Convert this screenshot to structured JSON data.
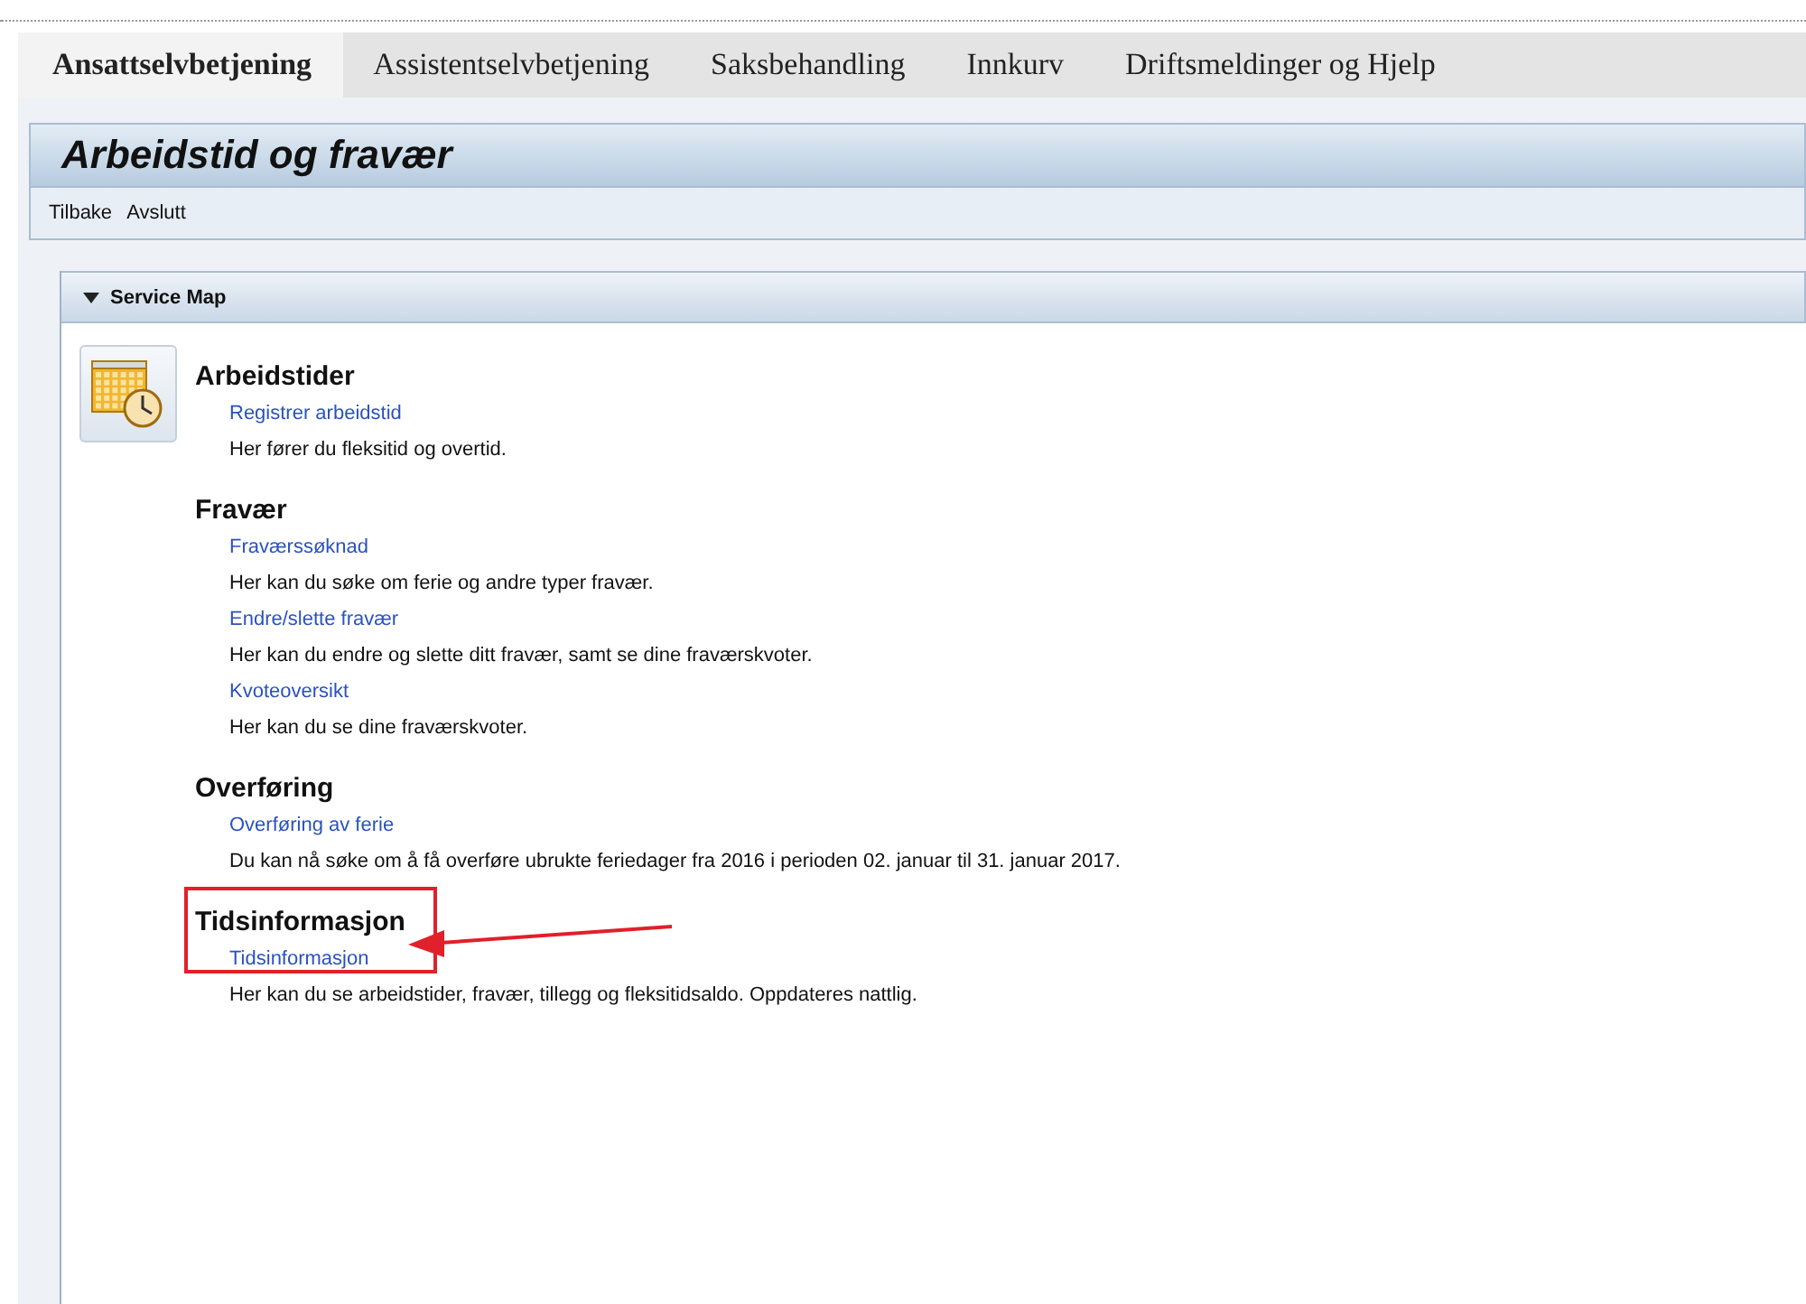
{
  "tabs": [
    {
      "label": "Ansattselvbetjening",
      "selected": true
    },
    {
      "label": "Assistentselvbetjening",
      "selected": false
    },
    {
      "label": "Saksbehandling",
      "selected": false
    },
    {
      "label": "Innkurv",
      "selected": false
    },
    {
      "label": "Driftsmeldinger og Hjelp",
      "selected": false
    }
  ],
  "page": {
    "title": "Arbeidstid og fravær",
    "toolbar": [
      "Tilbake",
      "Avslutt"
    ]
  },
  "service_map": {
    "title": "Service Map",
    "expanded": true,
    "sections": [
      {
        "heading": "Arbeidstider",
        "has_icon": true,
        "highlighted": false,
        "items": [
          {
            "link": "Registrer arbeidstid",
            "description": "Her fører du fleksitid og overtid."
          }
        ]
      },
      {
        "heading": "Fravær",
        "has_icon": false,
        "highlighted": false,
        "items": [
          {
            "link": "Fraværssøknad",
            "description": "Her kan du søke om ferie og andre typer fravær."
          },
          {
            "link": "Endre/slette fravær",
            "description": "Her kan du endre og slette ditt fravær, samt se dine fraværskvoter."
          },
          {
            "link": "Kvoteoversikt",
            "description": "Her kan du se dine fraværskvoter."
          }
        ]
      },
      {
        "heading": "Overføring",
        "has_icon": false,
        "highlighted": false,
        "items": [
          {
            "link": "Overføring av ferie",
            "description": "Du kan nå søke om å få overføre ubrukte feriedager fra 2016 i perioden 02. januar til 31. januar 2017."
          }
        ]
      },
      {
        "heading": "Tidsinformasjon",
        "has_icon": false,
        "highlighted": true,
        "items": [
          {
            "link": "Tidsinformasjon",
            "description": "Her kan du se arbeidstider, fravær, tillegg og fleksitidsaldo. Oppdateres nattlig."
          }
        ]
      }
    ]
  }
}
